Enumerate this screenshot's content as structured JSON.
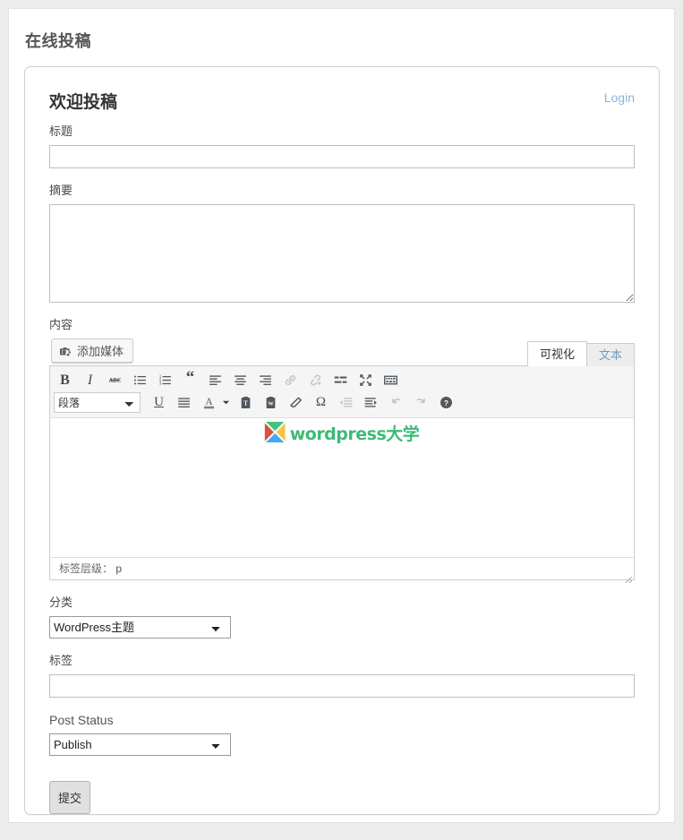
{
  "page": {
    "title": "在线投稿"
  },
  "card": {
    "heading": "欢迎投稿",
    "login_label": "Login"
  },
  "fields": {
    "title_label": "标题",
    "title_value": "",
    "excerpt_label": "摘要",
    "excerpt_value": "",
    "content_label": "内容",
    "category_label": "分类",
    "category_value": "WordPress主题",
    "category_options": [
      "WordPress主题"
    ],
    "tags_label": "标签",
    "tags_value": "",
    "post_status_label": "Post Status",
    "post_status_value": "Publish",
    "post_status_options": [
      "Publish"
    ]
  },
  "editor": {
    "add_media_label": "添加媒体",
    "tab_visual": "可视化",
    "tab_text": "文本",
    "format_select_value": "段落",
    "format_options": [
      "段落"
    ],
    "status_label": "标签层级：",
    "status_path": "p",
    "watermark_text_en": "wordpress",
    "watermark_text_cn": "大学",
    "toolbar_row1": [
      "bold-icon",
      "italic-icon",
      "strikethrough-icon",
      "unordered-list-icon",
      "ordered-list-icon",
      "blockquote-icon",
      "align-left-icon",
      "align-center-icon",
      "align-right-icon",
      "link-icon",
      "unlink-icon",
      "insert-more-icon",
      "fullscreen-icon",
      "toolbar-toggle-icon"
    ],
    "toolbar_row2": [
      "underline-icon",
      "align-justify-icon",
      "text-color-icon",
      "paste-as-text-icon",
      "paste-from-word-icon",
      "remove-format-icon",
      "special-char-icon",
      "outdent-icon",
      "indent-icon",
      "undo-icon",
      "redo-icon",
      "help-icon"
    ]
  },
  "actions": {
    "submit_label": "提交"
  },
  "colors": {
    "page_bg": "#ececec",
    "panel_bg": "#ffffff",
    "accent_link": "#8cb3d9",
    "logo_green": "#3dba77",
    "icon": "#50575e",
    "icon_disabled": "#c3c4c7"
  }
}
